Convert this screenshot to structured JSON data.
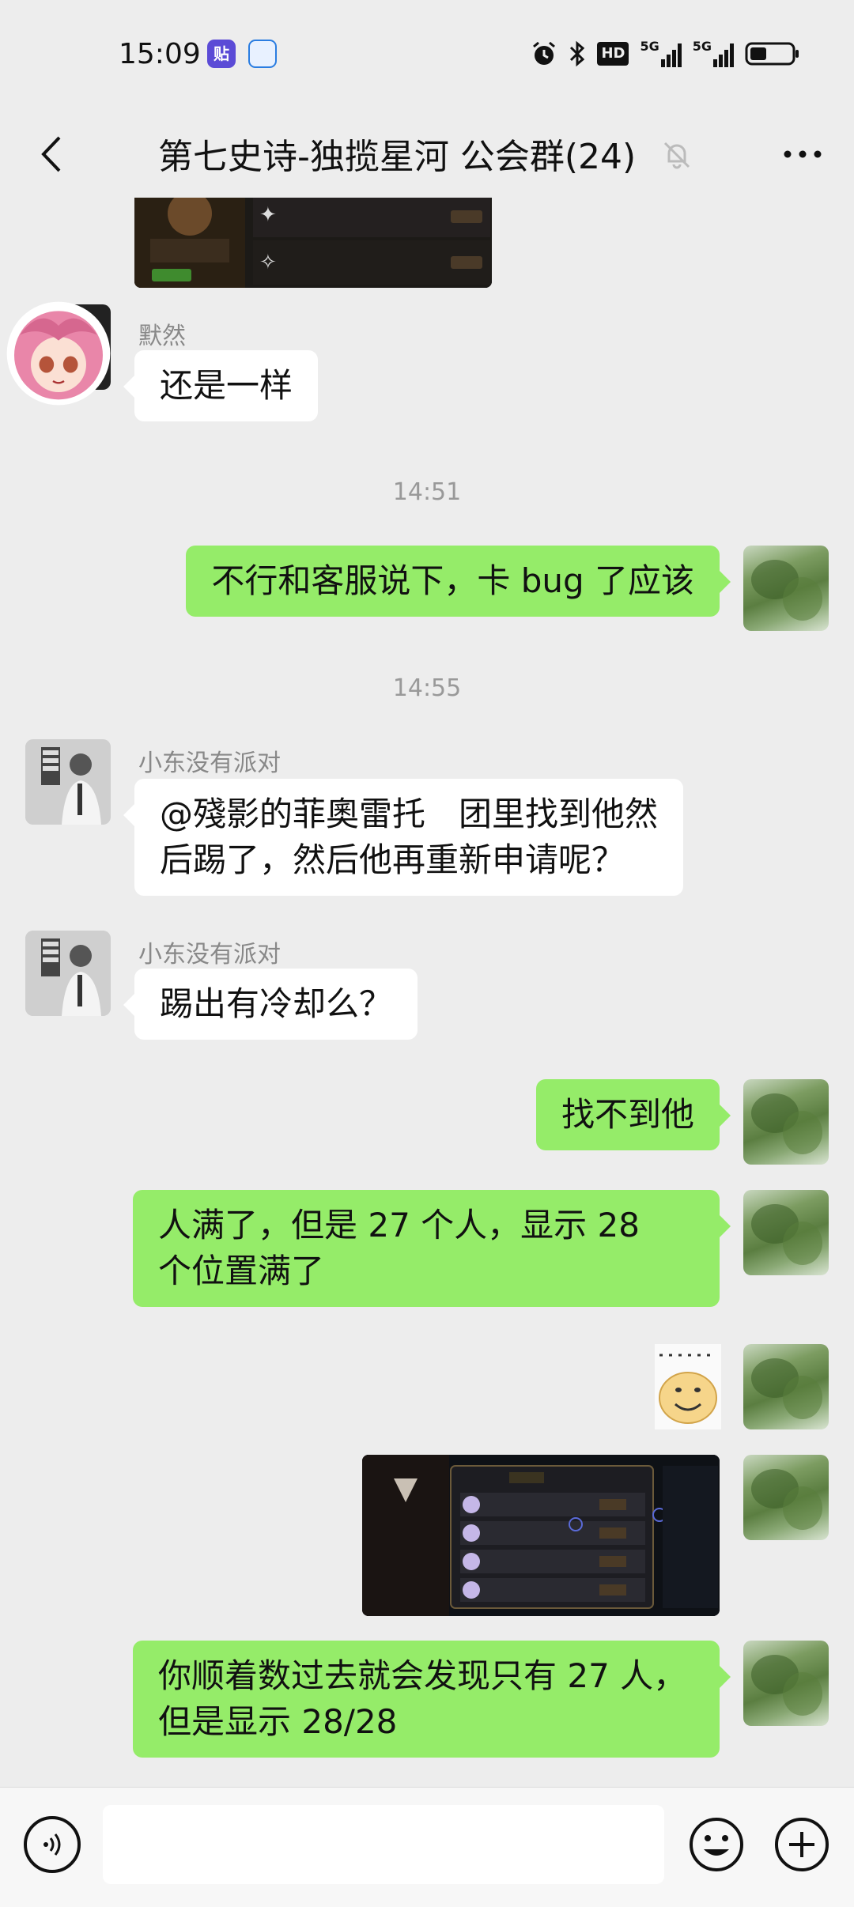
{
  "status": {
    "time": "15:09",
    "tieba_icon_text": "贴",
    "icons": [
      "alarm-icon",
      "bluetooth-icon",
      "hd-icon",
      "5g-signal-icon",
      "5g-signal-icon",
      "battery-icon"
    ],
    "hd_label": "HD",
    "signal1_label": "5G",
    "signal2_label": "5G"
  },
  "header": {
    "title": "第七史诗-独揽星河 公会群(24)",
    "back_icon": "chevron-left-icon",
    "mute_icon": "bell-muted-icon",
    "more_icon": "more-dots-icon"
  },
  "messages": [
    {
      "type": "image",
      "direction": "in",
      "description": "game-screenshot"
    },
    {
      "type": "text",
      "direction": "in",
      "sender": "默然",
      "text": "还是一样"
    },
    {
      "type": "time",
      "text": "14:51"
    },
    {
      "type": "text",
      "direction": "out",
      "text": "不行和客服说下，卡 bug 了应该"
    },
    {
      "type": "time",
      "text": "14:55"
    },
    {
      "type": "text",
      "direction": "in",
      "sender": "小东没有派对",
      "text": "@殘影的菲奧雷托　团里找到他然\n后踢了，然后他再重新申请呢？"
    },
    {
      "type": "text",
      "direction": "in",
      "sender": "小东没有派对",
      "text": "踢出有冷却么？"
    },
    {
      "type": "text",
      "direction": "out",
      "text": "找不到他"
    },
    {
      "type": "text",
      "direction": "out",
      "text": "人满了，但是 27 个人，显示 28\n个位置满了"
    },
    {
      "type": "sticker",
      "direction": "out"
    },
    {
      "type": "image",
      "direction": "out",
      "description": "game-screenshot"
    },
    {
      "type": "text",
      "direction": "out",
      "text": "你顺着数过去就会发现只有 27 人，\n但是显示 28/28"
    }
  ],
  "input_bar": {
    "voice_icon": "voice-icon",
    "emoji_icon": "emoji-icon",
    "plus_icon": "plus-icon",
    "input_value": ""
  },
  "colors": {
    "background": "#ededed",
    "outgoing_bubble": "#95ec69",
    "incoming_bubble": "#ffffff",
    "meta_text": "#999999"
  }
}
